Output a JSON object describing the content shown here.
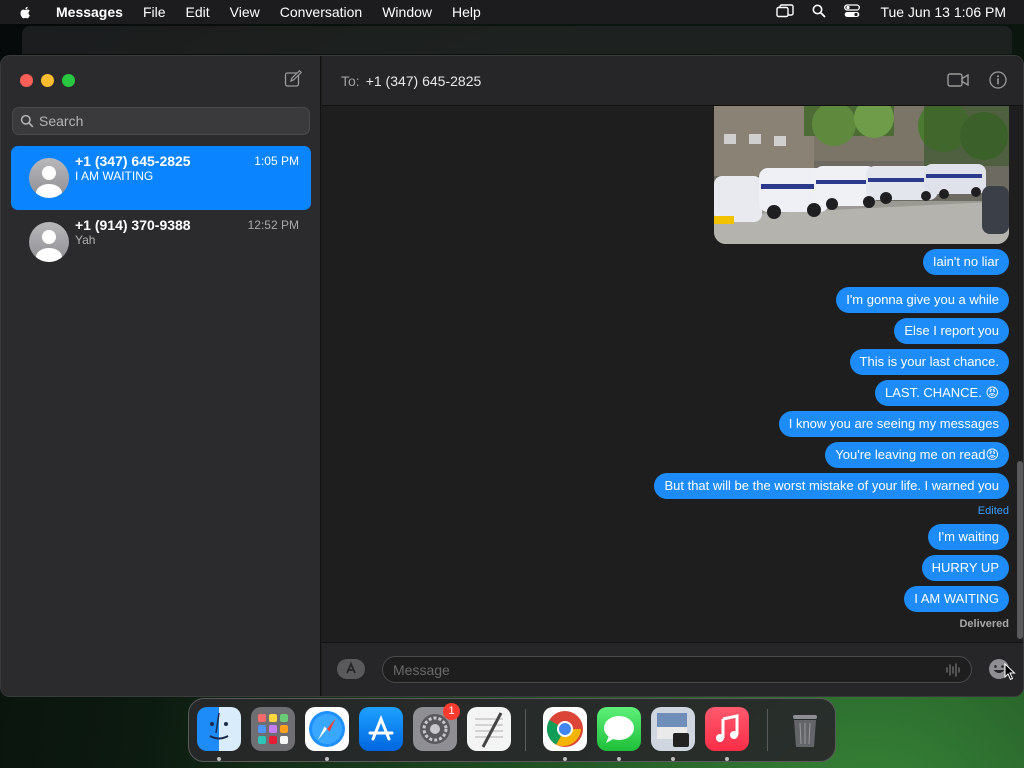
{
  "menubar": {
    "app": "Messages",
    "items": [
      "File",
      "Edit",
      "View",
      "Conversation",
      "Window",
      "Help"
    ],
    "clock": "Tue Jun 13  1:06 PM"
  },
  "sidebar": {
    "search_placeholder": "Search",
    "conversations": [
      {
        "name": "+1 (347) 645-2825",
        "preview": "I AM WAITING",
        "time": "1:05 PM",
        "selected": true
      },
      {
        "name": "+1 (914) 370-9388",
        "preview": "Yah",
        "time": "12:52 PM",
        "selected": false
      }
    ]
  },
  "chat": {
    "to_label": "To:",
    "to_value": "+1 (347) 645-2825",
    "messages": [
      "Iain't no liar",
      "I'm gonna give you a while",
      "Else I report you",
      "This is your last chance.",
      "LAST. CHANCE. 😡",
      "I know you are seeing my messages",
      "You're leaving me on read😡",
      "But that will be the worst mistake of your life. I warned you",
      "I'm waiting",
      "HURRY UP",
      "I AM WAITING"
    ],
    "edited_label": "Edited",
    "delivered_label": "Delivered",
    "input_placeholder": "Message"
  },
  "dock": {
    "apps": [
      "finder-icon",
      "launchpad-icon",
      "safari-icon",
      "app-store-icon",
      "system-settings-icon",
      "textedit-icon",
      "chrome-icon",
      "messages-icon",
      "preview-icon",
      "music-icon",
      "trash-icon"
    ],
    "settings_badge": "1"
  },
  "colors": {
    "accent": "#0a84ff",
    "bubble": "#1d8cf8",
    "edited": "#3a9dff"
  }
}
